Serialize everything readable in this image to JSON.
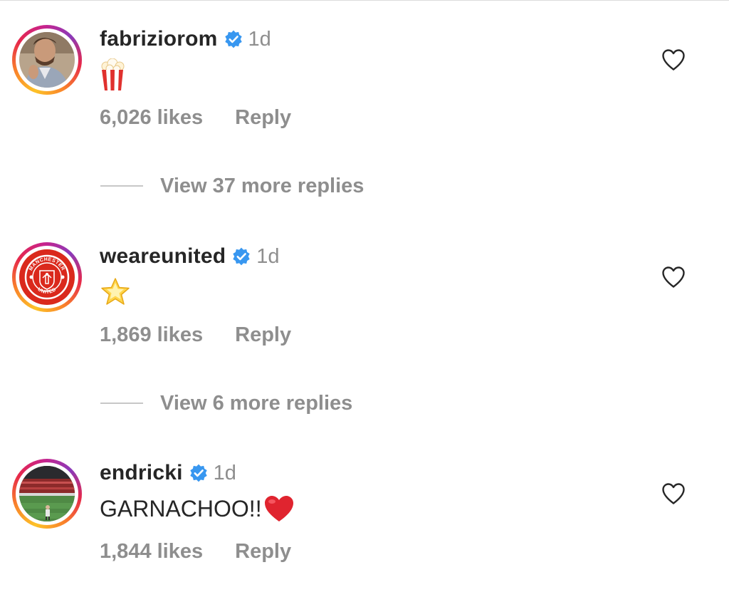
{
  "colors": {
    "text_primary": "#262626",
    "text_secondary": "#8e8e8e",
    "verified_blue": "#3897f0",
    "united_red": "#da291c"
  },
  "comments": [
    {
      "username": "fabriziorom",
      "verified": true,
      "time": "1d",
      "text": "",
      "emoji": "popcorn",
      "likes": "6,026 likes",
      "reply_label": "Reply",
      "view_replies": "View 37 more replies",
      "avatar_icon": "man-portrait"
    },
    {
      "username": "weareunited",
      "verified": true,
      "time": "1d",
      "text": "",
      "emoji": "glowing-star",
      "likes": "1,869 likes",
      "reply_label": "Reply",
      "view_replies": "View 6 more replies",
      "avatar_icon": "manchester-united-crest",
      "avatar_text_top": "MANCHESTER",
      "avatar_text_bottom": "UNITED"
    },
    {
      "username": "endricki",
      "verified": true,
      "time": "1d",
      "text": "GARNACHOO!!",
      "emoji": "red-heart",
      "likes": "1,844 likes",
      "reply_label": "Reply",
      "avatar_icon": "stadium-photo"
    }
  ]
}
